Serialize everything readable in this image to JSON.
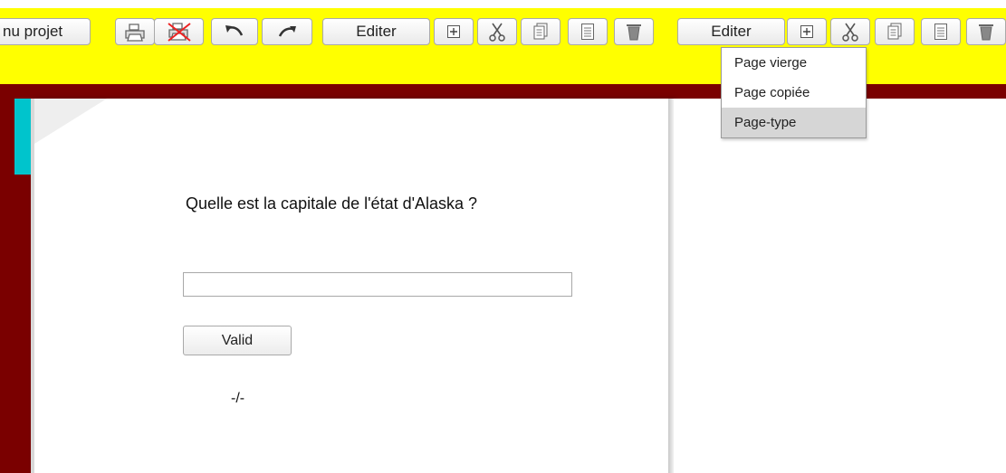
{
  "toolbar": {
    "project_label": "nu projet",
    "group1": {
      "edit_label": "Editer",
      "icons": [
        "print-icon",
        "no-print-icon",
        "undo-icon",
        "redo-icon",
        "add-icon",
        "scissors-icon",
        "copy-icon",
        "paste-icon",
        "trash-icon"
      ]
    },
    "group2": {
      "edit_label": "Editer"
    },
    "colors": {
      "background": "#ffff00",
      "frame": "#7a0000",
      "tab": "#00c4cc"
    }
  },
  "dropdown": {
    "items": [
      {
        "label": "Page vierge"
      },
      {
        "label": "Page copiée"
      },
      {
        "label": "Page-type",
        "highlighted": true
      }
    ]
  },
  "page": {
    "question": "Quelle est la capitale de l'état d'Alaska ?",
    "answer_value": "",
    "valid_label": "Valid",
    "score": "-/-"
  }
}
